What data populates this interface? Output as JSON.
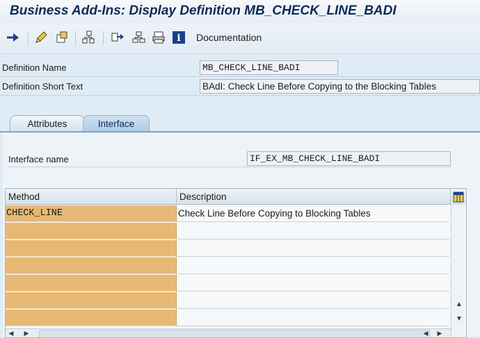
{
  "window": {
    "title": "Business Add-Ins: Display Definition MB_CHECK_LINE_BADI"
  },
  "toolbar": {
    "documentation_label": "Documentation"
  },
  "header": {
    "definition_name_label": "Definition Name",
    "definition_name_value": "MB_CHECK_LINE_BADI",
    "short_text_label": "Definition Short Text",
    "short_text_value": "BAdI: Check Line Before Copying to the Blocking Tables"
  },
  "tabs": [
    {
      "label": "Attributes",
      "active": false
    },
    {
      "label": "Interface",
      "active": true
    }
  ],
  "interface": {
    "name_label": "Interface name",
    "name_value": "IF_EX_MB_CHECK_LINE_BADI"
  },
  "methods_table": {
    "columns": [
      "Method",
      "Description"
    ],
    "rows": [
      {
        "method": "CHECK_LINE",
        "description": "Check Line Before Copying to Blocking Tables"
      },
      {
        "method": "",
        "description": ""
      },
      {
        "method": "",
        "description": ""
      },
      {
        "method": "",
        "description": ""
      },
      {
        "method": "",
        "description": ""
      },
      {
        "method": "",
        "description": ""
      },
      {
        "method": "",
        "description": ""
      }
    ]
  },
  "colors": {
    "accent": "#0d2b57",
    "method_cell": "#e7b873",
    "tab_active": "#aecbe6"
  }
}
